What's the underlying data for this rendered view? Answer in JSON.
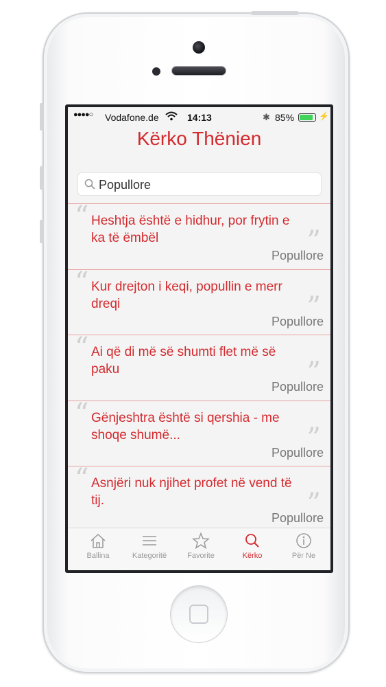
{
  "status_bar": {
    "signal": "●●●●○",
    "carrier": "Vodafone.de",
    "time": "14:13",
    "battery_percent": "85%",
    "battery_level": 0.85
  },
  "header": {
    "title": "Kërko Thënien"
  },
  "search": {
    "value": "Popullore",
    "placeholder": ""
  },
  "quotes": [
    {
      "text": "Heshtja është e hidhur, por frytin e ka të ëmbël",
      "author": "Popullore"
    },
    {
      "text": "Kur drejton i keqi, popullin e merr dreqi",
      "author": "Popullore"
    },
    {
      "text": "Ai që di më së shumti flet më së paku",
      "author": "Popullore"
    },
    {
      "text": "Gënjeshtra është si qershia - me shoqe shumë...",
      "author": "Popullore"
    },
    {
      "text": "Asnjëri nuk njihet profet në vend të tij.",
      "author": "Popullore"
    }
  ],
  "tabs": [
    {
      "label": "Ballina",
      "icon": "home-icon",
      "active": false
    },
    {
      "label": "Kategoritë",
      "icon": "menu-icon",
      "active": false
    },
    {
      "label": "Favorite",
      "icon": "star-icon",
      "active": false
    },
    {
      "label": "Kërko",
      "icon": "search-icon",
      "active": true
    },
    {
      "label": "Për Ne",
      "icon": "info-icon",
      "active": false
    }
  ],
  "colors": {
    "accent": "#d32a2e",
    "inactive": "#9a9a9a",
    "battery": "#3fd35a"
  }
}
